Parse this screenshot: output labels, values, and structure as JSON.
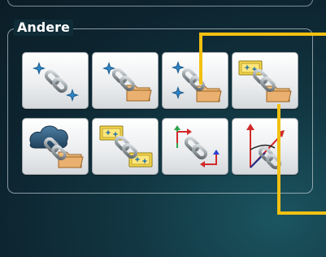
{
  "group": {
    "title": "Andere"
  },
  "buttons": [
    {
      "icon": "link-points-icon"
    },
    {
      "icon": "link-point-folder-icon"
    },
    {
      "icon": "link-points-folder-icon"
    },
    {
      "icon": "link-folder-folder-icon"
    },
    {
      "icon": "link-cloud-folder-icon"
    },
    {
      "icon": "link-folders-icon"
    },
    {
      "icon": "link-coordinate-systems-icon"
    },
    {
      "icon": "link-angle-axes-icon"
    }
  ],
  "colors": {
    "callout": "#f2c012",
    "background": "#0f2c37",
    "folder": "#e4a85c",
    "link": "#9aa3a8"
  }
}
